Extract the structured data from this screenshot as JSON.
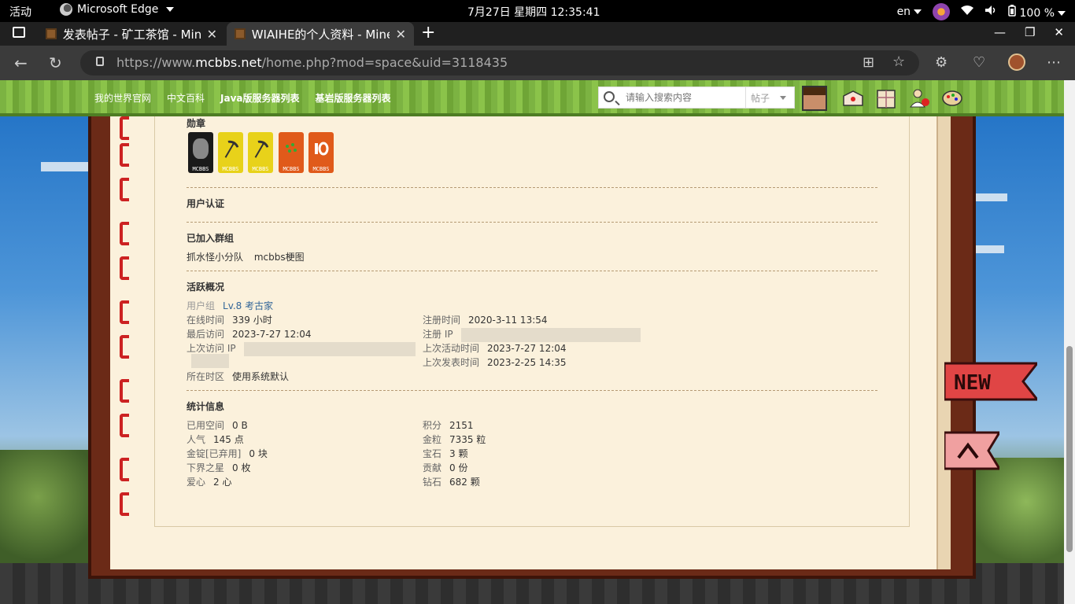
{
  "topbar": {
    "activities": "活动",
    "app_name": "Microsoft Edge",
    "clock": "7月27日 星期四  12:35:41",
    "lang": "en",
    "battery": "100 %"
  },
  "tabs": [
    {
      "title": "发表帖子 - 矿工茶馆 - Min",
      "active": false
    },
    {
      "title": "WIAIHE的个人资料 - Mine",
      "active": true
    }
  ],
  "address": {
    "prefix": "https://www.",
    "domain": "mcbbs.net",
    "path": "/home.php?mod=space&uid=3118435"
  },
  "site_nav": {
    "links": [
      "我的世界官网",
      "中文百科",
      "Java版服务器列表",
      "基岩版服务器列表"
    ],
    "search_placeholder": "请输入搜索内容",
    "search_scope": "帖子"
  },
  "profile": {
    "medals_title": "勋章",
    "medals": [
      {
        "label": "MCBBS",
        "color": "#1a1a1a"
      },
      {
        "label": "MCBBS",
        "color": "#e8d21a"
      },
      {
        "label": "MCBBS",
        "color": "#e8d21a"
      },
      {
        "label": "MCBBS",
        "color": "#e05a1a"
      },
      {
        "label": "MCBBS",
        "color": "#e05a1a"
      }
    ],
    "auth_title": "用户认证",
    "groups_title": "已加入群组",
    "groups": [
      "抓水怪小分队",
      "mcbbs梗图"
    ],
    "activity_title": "活跃概况",
    "activity": {
      "usergroup_key": "用户组",
      "usergroup_val": "Lv.8 考古家",
      "online_key": "在线时间",
      "online_val": "339 小时",
      "register_key": "注册时间",
      "register_val": "2020-3-11 13:54",
      "last_visit_key": "最后访问",
      "last_visit_val": "2023-7-27 12:04",
      "reg_ip_key": "注册 IP",
      "last_ip_key": "上次访问 IP",
      "last_active_key": "上次活动时间",
      "last_active_val": "2023-7-27 12:04",
      "last_post_key": "上次发表时间",
      "last_post_val": "2023-2-25 14:35",
      "timezone_key": "所在时区",
      "timezone_val": "使用系统默认"
    },
    "stats_title": "统计信息",
    "stats_left": [
      {
        "k": "已用空间",
        "v": "0 B"
      },
      {
        "k": "人气",
        "v": "145 点"
      },
      {
        "k": "金锭[已弃用]",
        "v": "0 块"
      },
      {
        "k": "下界之星",
        "v": "0 枚"
      },
      {
        "k": "爱心",
        "v": "2 心"
      }
    ],
    "stats_right": [
      {
        "k": "积分",
        "v": "2151"
      },
      {
        "k": "金粒",
        "v": "7335 粒"
      },
      {
        "k": "宝石",
        "v": "3 颗"
      },
      {
        "k": "贡献",
        "v": "0 份"
      },
      {
        "k": "钻石",
        "v": "682 颗"
      }
    ]
  },
  "side_flags": {
    "new": "NEW"
  }
}
